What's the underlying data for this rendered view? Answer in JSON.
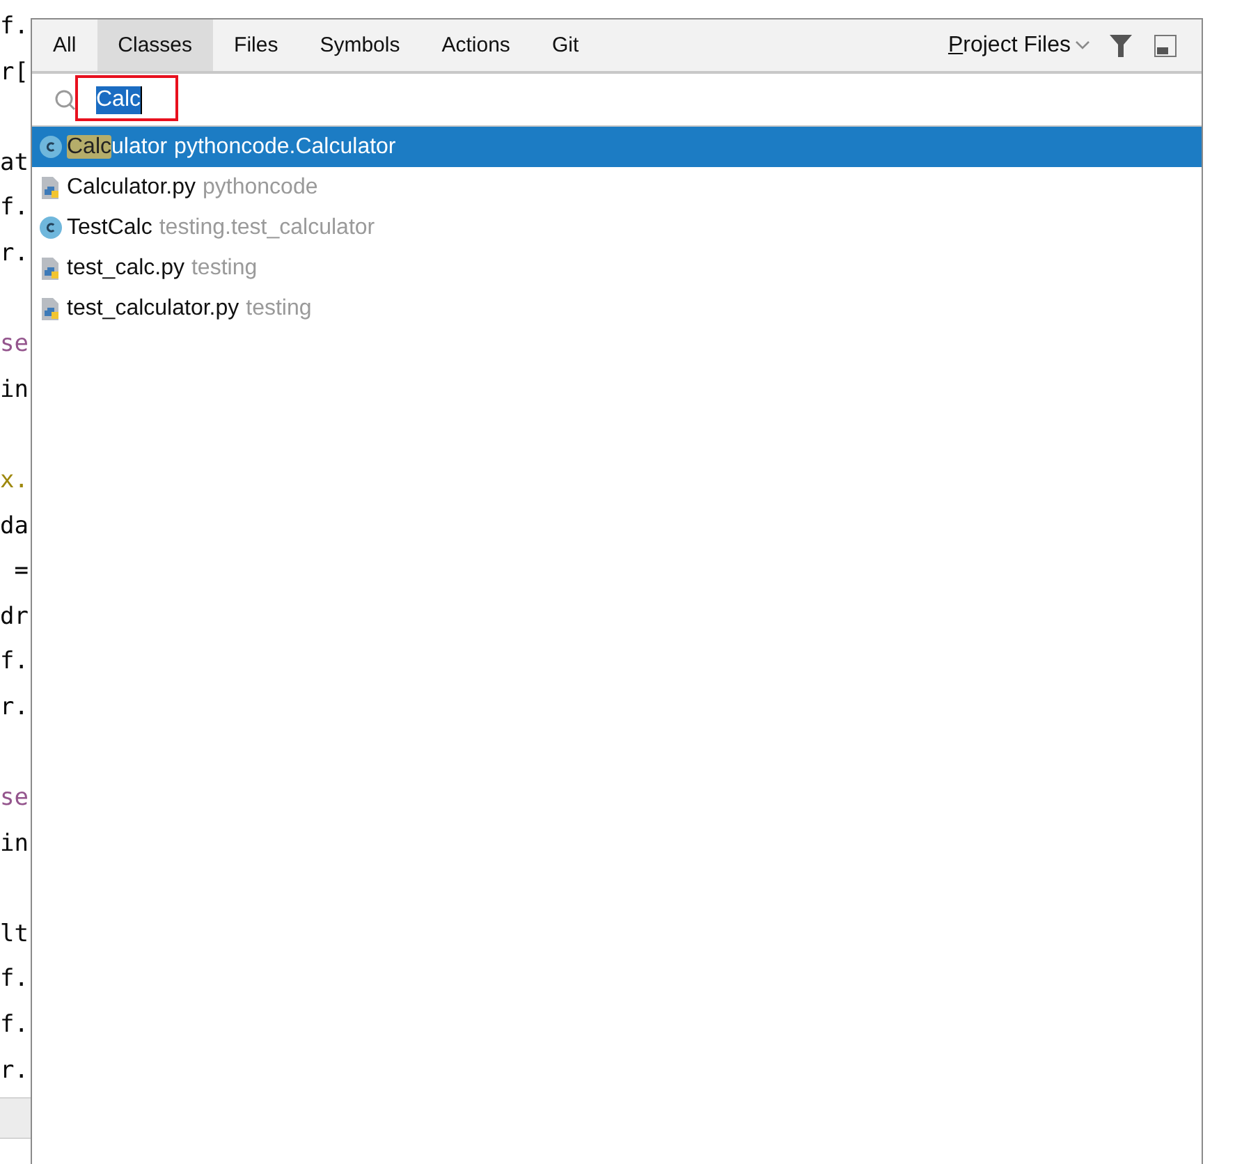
{
  "editor": {
    "lines": [
      {
        "text": "f.",
        "kind": "plain"
      },
      {
        "text": "r[",
        "kind": "plain"
      },
      {
        "kind": "blank"
      },
      {
        "text": "at",
        "kind": "plain"
      },
      {
        "text": "f.",
        "kind": "plain"
      },
      {
        "text": "r.",
        "kind": "plain"
      },
      {
        "kind": "blank"
      },
      {
        "text": "se",
        "kind": "keyword"
      },
      {
        "text": "in",
        "kind": "plain"
      },
      {
        "kind": "blank"
      },
      {
        "text": "x.",
        "kind": "decorator"
      },
      {
        "text": "da",
        "kind": "plain"
      },
      {
        "text": " =",
        "kind": "plain"
      },
      {
        "text": "dr",
        "kind": "plain"
      },
      {
        "text": "f.",
        "kind": "plain"
      },
      {
        "text": "r.",
        "kind": "plain"
      },
      {
        "kind": "blank"
      },
      {
        "text": "se",
        "kind": "keyword"
      },
      {
        "text": "in",
        "kind": "plain"
      },
      {
        "kind": "blank"
      },
      {
        "text": "lt",
        "kind": "plain"
      },
      {
        "text": "f.",
        "kind": "plain"
      },
      {
        "text": "f.",
        "kind": "plain"
      },
      {
        "text": "r.",
        "kind": "plain"
      }
    ]
  },
  "popup": {
    "tabs": [
      {
        "label": "All",
        "selected": false
      },
      {
        "label": "Classes",
        "selected": true
      },
      {
        "label": "Files",
        "selected": false
      },
      {
        "label": "Symbols",
        "selected": false
      },
      {
        "label": "Actions",
        "selected": false
      },
      {
        "label": "Git",
        "selected": false
      }
    ],
    "scope": "Project Files",
    "search": {
      "value": "Calc"
    },
    "results": [
      {
        "kind": "class",
        "match": "Calc",
        "name": "ulator",
        "location": "pythoncode.Calculator",
        "selected": true
      },
      {
        "kind": "python-file",
        "name": "Calculator.py",
        "location": "pythoncode",
        "selected": false
      },
      {
        "kind": "class",
        "name": "TestCalc",
        "location": "testing.test_calculator",
        "selected": false
      },
      {
        "kind": "python-file",
        "name": "test_calc.py",
        "location": "testing",
        "selected": false
      },
      {
        "kind": "python-file",
        "name": "test_calculator.py",
        "location": "testing",
        "selected": false
      }
    ]
  }
}
